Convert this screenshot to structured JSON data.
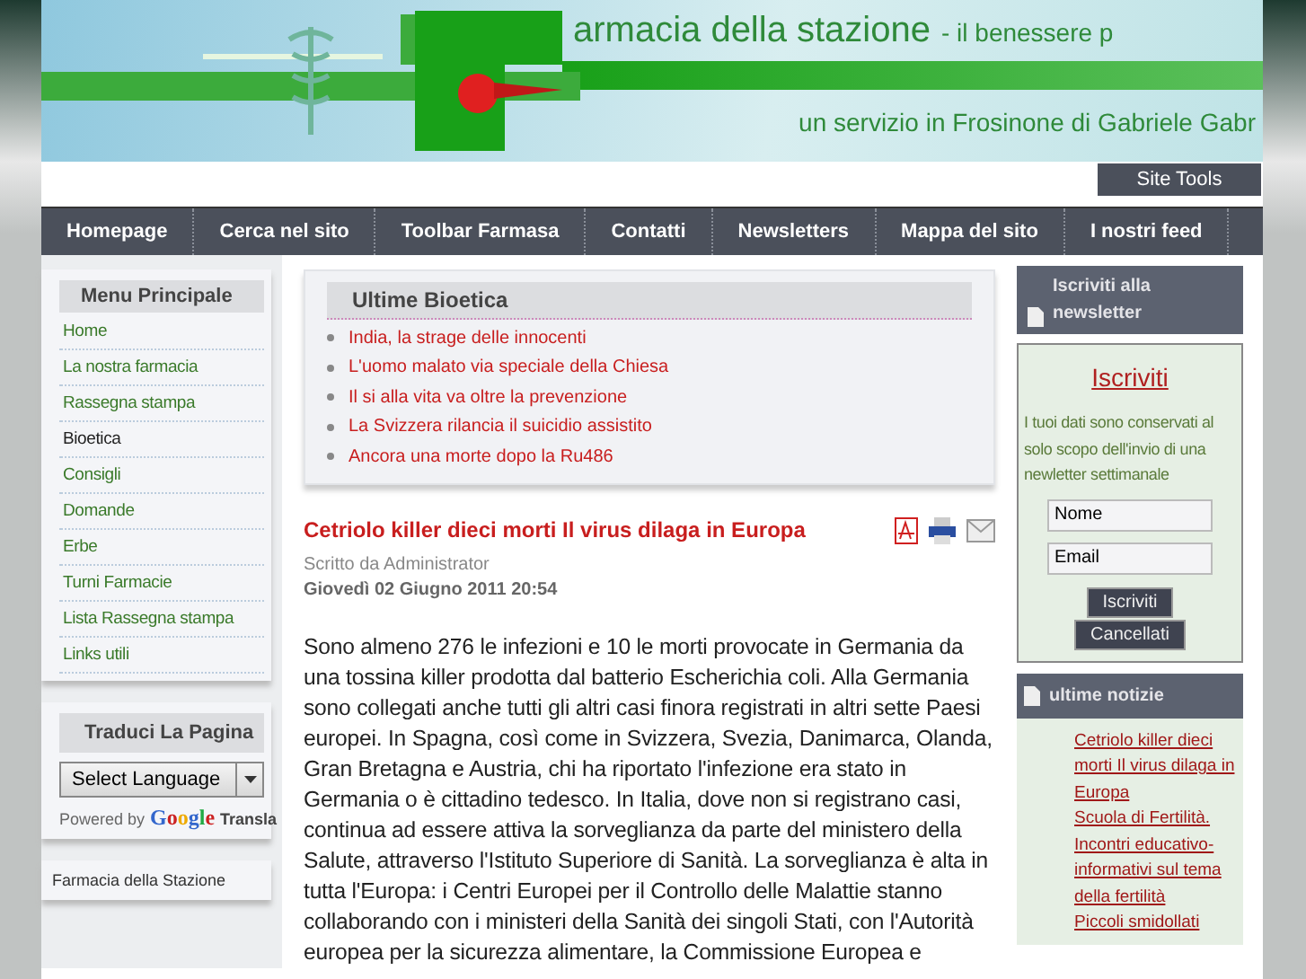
{
  "banner": {
    "title": "armacia della stazione",
    "tagline_suffix": "- il benessere p",
    "subtitle": "un servizio in Frosinone di Gabriele Gabr"
  },
  "site_tools": "Site Tools",
  "nav": [
    {
      "label": "Homepage"
    },
    {
      "label": "Cerca nel sito"
    },
    {
      "label": "Toolbar Farmasa"
    },
    {
      "label": "Contatti"
    },
    {
      "label": "Newsletters"
    },
    {
      "label": "Mappa del sito"
    },
    {
      "label": "I nostri feed"
    }
  ],
  "main_menu": {
    "title": "Menu Principale",
    "items": [
      {
        "label": "Home",
        "selected": false
      },
      {
        "label": "La nostra farmacia",
        "selected": false
      },
      {
        "label": "Rassegna stampa",
        "selected": false
      },
      {
        "label": "Bioetica",
        "selected": true
      },
      {
        "label": "Consigli",
        "selected": false
      },
      {
        "label": "Domande",
        "selected": false
      },
      {
        "label": "Erbe",
        "selected": false
      },
      {
        "label": "Turni Farmacie",
        "selected": false
      },
      {
        "label": "Lista Rassegna stampa",
        "selected": false
      },
      {
        "label": "Links utili",
        "selected": false
      }
    ]
  },
  "translate": {
    "title": "Traduci La Pagina",
    "select": "Select Language",
    "powered_by": "Powered by",
    "google": "Google",
    "translate": "Transla"
  },
  "bottom_box": "Farmacia della Stazione",
  "bioetica": {
    "title": "Ultime Bioetica",
    "items": [
      "India, la strage delle innocenti",
      "L'uomo malato via speciale della Chiesa",
      "Il si alla vita va oltre la prevenzione",
      "La Svizzera rilancia il suicidio assistito",
      "Ancora una morte dopo la Ru486"
    ]
  },
  "article": {
    "title": "Cetriolo killer dieci morti Il virus dilaga in Europa",
    "author": "Scritto da Administrator",
    "date": "Giovedì 02 Giugno 2011 20:54",
    "body": "Sono almeno 276 le infezioni e 10 le morti provocate in Germania da una tossina killer prodotta dal batterio Escherichia coli. Alla Germania sono collegati anche tutti gli altri casi  finora registrati in altri sette Paesi europei. In Spagna, così come in Svizzera, Svezia, Danimarca, Olanda, Gran Bretagna e Austria, chi ha riportato l'infezione era stato in Germania o è cittadino tedesco. In Italia, dove non si registrano casi, continua ad essere attiva la sorveglianza da parte del ministero della Salute, attraverso l'Istituto Superiore di Sanità. La sorveglianza è alta in tutta l'Europa: i Centri Europei per il Controllo delle Malattie stanno collaborando con i ministeri della Sanità dei singoli Stati, con l'Autorità europea per la sicurezza alimentare, la Commissione Europea e"
  },
  "newsletter": {
    "header": "Iscriviti alla newsletter",
    "title": "Iscriviti",
    "text": "I tuoi dati sono conservati al solo scopo dell'invio di una newletter settimanale",
    "name_value": "Nome",
    "email_value": "Email",
    "subscribe": "Iscriviti",
    "unsubscribe": "Cancellati"
  },
  "news": {
    "header": "ultime notizie",
    "items": [
      "Cetriolo killer dieci morti Il virus dilaga in Europa",
      "Scuola di Fertilità. Incontri educativo-informativi sul tema della fertilità",
      "Piccoli smidollati"
    ]
  }
}
